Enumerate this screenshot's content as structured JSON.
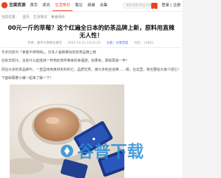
{
  "app": {
    "name": "豆腐资源"
  },
  "nav": {
    "items": [
      {
        "label": "首页"
      },
      {
        "label": "资讯"
      },
      {
        "label": "生活常识"
      },
      {
        "label": "笔记"
      },
      {
        "label": "商城"
      },
      {
        "label": "合集"
      }
    ],
    "active_index": 2
  },
  "search": {
    "placeholder": "搜索话题/商品/问题"
  },
  "login": {
    "label": "登录 | 注册"
  },
  "breadcrumb": [
    "当前位置：",
    "首页",
    "生活常识",
    "美食百科"
  ],
  "article": {
    "title_line1": "00元一斤的草莓？这个红遍全日本的奶茶品牌上新，原料用直辣",
    "title_line2": "无人性！",
    "meta": {
      "author": "作者：趣享大咖网主题馆",
      "time": "2020-10-12 14:22:22",
      "tag": "分类：分值百度",
      "views": "浏览：13983"
    },
    "summary": "今天内容为「食客不停地喝」，日本人最新推出的奶茶品牌上新",
    "paragraphs": [
      "在秋日阴冷，没有什么能抵挡一杯热奶茶所带来的幸福感，如果有，那就再来一杯！",
      "而在众多奶茶品牌中，一直坚持用真材实料的它，品质优秀，被众多粉丝追捧……嗯，在这里，我也要给大家介绍它！",
      "下面就跟着小编一起来了解一下！"
    ]
  },
  "photo": {
    "label": "article-photo"
  },
  "watermark": {
    "text": "谷普下载"
  },
  "colors": {
    "accent": "#e8431f",
    "link": "#4e6ef2"
  }
}
